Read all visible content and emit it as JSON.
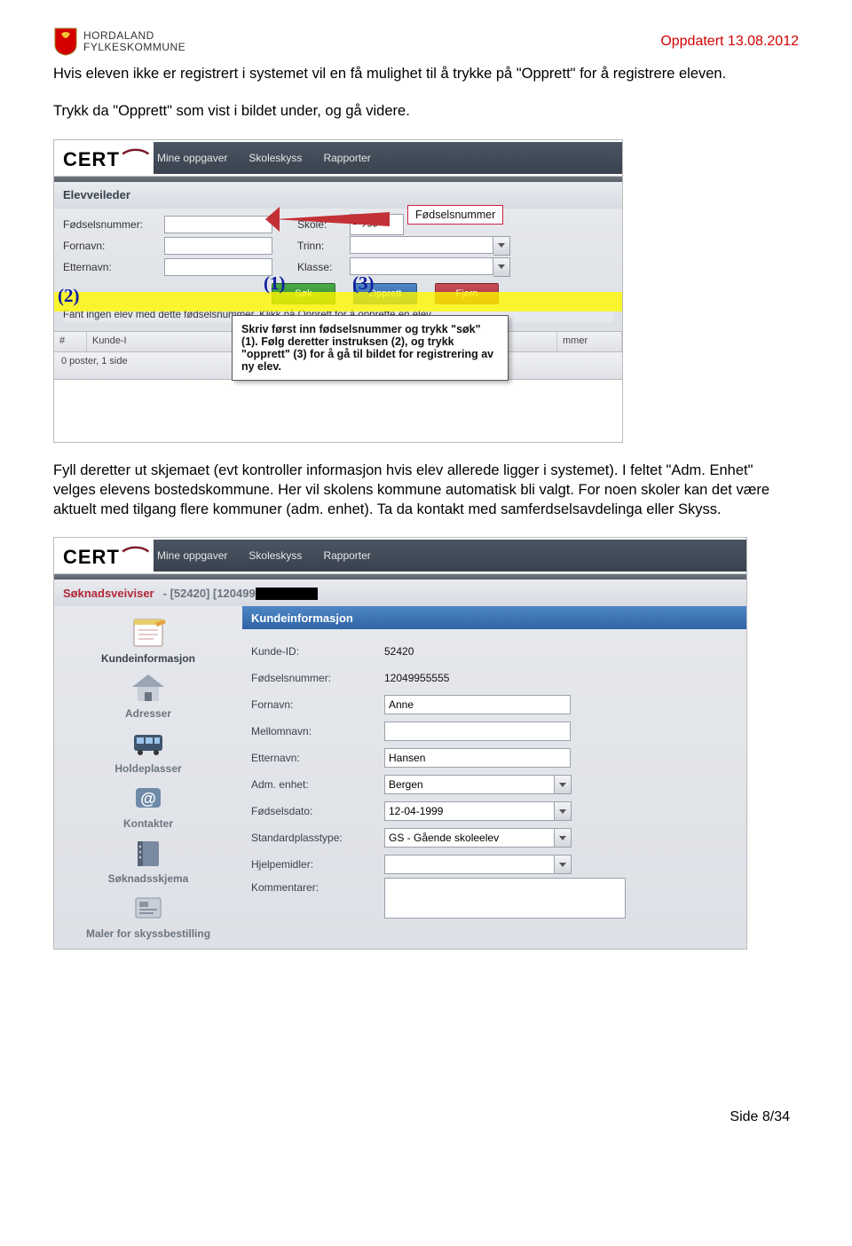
{
  "header": {
    "org_line1": "HORDALAND",
    "org_line2": "FYLKESKOMMUNE",
    "updated": "Oppdatert 13.08.2012"
  },
  "p1": "Hvis eleven ikke er registrert i systemet vil en få mulighet til å trykke på \"Opprett\" for å registrere eleven.",
  "p2": "Trykk da \"Opprett\" som vist i bildet under, og gå videre.",
  "p3": "Fyll deretter ut skjemaet (evt kontroller informasjon hvis elev allerede ligger i systemet). I feltet \"Adm. Enhet\" velges elevens bostedskommune. Her vil skolens kommune automatisk bli valgt. For noen skoler kan det være aktuelt med tilgang flere kommuner (adm. enhet). Ta da kontakt med samferdselsavdelinga eller Skyss.",
  "sc1": {
    "menu": [
      "Mine oppgaver",
      "Skoleskyss",
      "Rapporter"
    ],
    "page_title": "Elevveileder",
    "fodselsnummer": "Fødselsnummer:",
    "skole": "Skole:",
    "skole_val": "Bryggen",
    "fornavn": "Fornavn:",
    "trinn": "Trinn:",
    "etternavn": "Etternavn:",
    "klasse": "Klasse:",
    "btn_sok": "Søk",
    "btn_opprett": "Opprett",
    "btn_fjern": "Fjern",
    "msg": "Fant ingen elev med dette fødselsnummer. Klikk på Opprett for å opprette en elev.",
    "th_kunde": "Kunde-I",
    "th_mmer": "mmer",
    "pager": "0 poster, 1 side",
    "ann1": "(1)",
    "ann2": "(2)",
    "ann3": "(3)",
    "fodtip": "Fødselsnummer",
    "tip": "Skriv først inn fødselsnummer og trykk \"søk\" (1). Følg deretter instruksen (2), og trykk \"opprett\" (3) for å gå til bildet for registrering av ny elev."
  },
  "sc2": {
    "menu": [
      "Mine oppgaver",
      "Skoleskyss",
      "Rapporter"
    ],
    "crumb_main": "Søknadsveiviser",
    "crumb_rest": "- [52420] [120499",
    "side": {
      "kundeinfo": "Kundeinformasjon",
      "adresser": "Adresser",
      "holdeplasser": "Holdeplasser",
      "kontakter": "Kontakter",
      "soknadsskjema": "Søknadsskjema",
      "maler": "Maler for skyssbestilling"
    },
    "section": "Kundeinformasjon",
    "fields": {
      "kundeid_l": "Kunde-ID:",
      "kundeid_v": "52420",
      "fnr_l": "Fødselsnummer:",
      "fnr_v": "12049955555",
      "fornavn_l": "Fornavn:",
      "fornavn_v": "Anne",
      "mellomnavn_l": "Mellomnavn:",
      "mellomnavn_v": "",
      "etternavn_l": "Etternavn:",
      "etternavn_v": "Hansen",
      "adm_l": "Adm. enhet:",
      "adm_v": "Bergen",
      "fdato_l": "Fødselsdato:",
      "fdato_v": "12-04-1999",
      "stdplass_l": "Standardplasstype:",
      "stdplass_v": "GS - Gående skoleelev",
      "hjelp_l": "Hjelpemidler:",
      "hjelp_v": "",
      "komm_l": "Kommentarer:"
    }
  },
  "footer": "Side 8/34"
}
